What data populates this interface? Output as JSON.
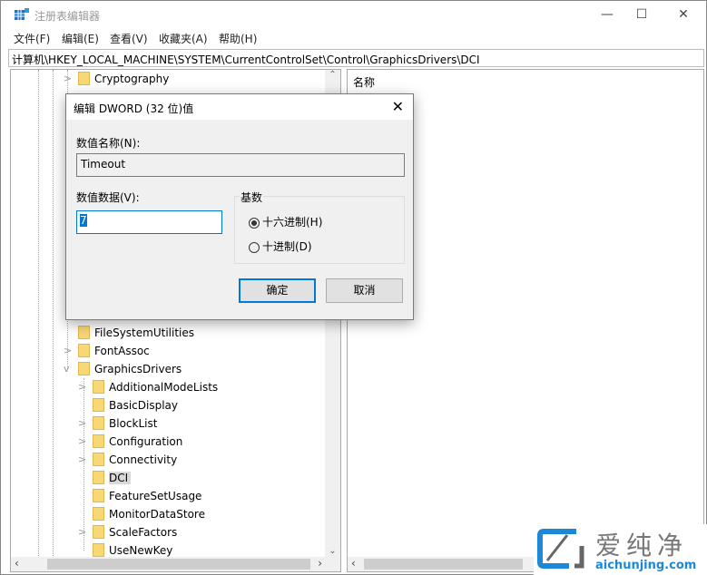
{
  "window": {
    "title": "注册表编辑器",
    "controls": [
      "—",
      "☐",
      "✕"
    ]
  },
  "menu": [
    "文件(F)",
    "编辑(E)",
    "查看(V)",
    "收藏夹(A)",
    "帮助(H)"
  ],
  "address": "计算机\\HKEY_LOCAL_MACHINE\\SYSTEM\\CurrentControlSet\\Control\\GraphicsDrivers\\DCI",
  "tree": {
    "level1": [
      {
        "label": "Cryptography",
        "expand": ">"
      },
      {
        "label": "FileSystemUtilities",
        "expand": ""
      },
      {
        "label": "FontAssoc",
        "expand": ">"
      },
      {
        "label": "GraphicsDrivers",
        "expand": "v"
      }
    ],
    "level2": [
      {
        "label": "AdditionalModeLists",
        "expand": ">"
      },
      {
        "label": "BasicDisplay",
        "expand": ""
      },
      {
        "label": "BlockList",
        "expand": ">"
      },
      {
        "label": "Configuration",
        "expand": ">"
      },
      {
        "label": "Connectivity",
        "expand": ">"
      },
      {
        "label": "DCI",
        "expand": "",
        "selected": true
      },
      {
        "label": "FeatureSetUsage",
        "expand": ""
      },
      {
        "label": "MonitorDataStore",
        "expand": ""
      },
      {
        "label": "ScaleFactors",
        "expand": ">"
      },
      {
        "label": "UseNewKey",
        "expand": ""
      }
    ]
  },
  "right": {
    "column_name": "名称"
  },
  "dialog": {
    "title": "编辑 DWORD (32 位)值",
    "name_label": "数值名称(N):",
    "name_value": "Timeout",
    "data_label": "数值数据(V):",
    "data_value": "7",
    "base_label": "基数",
    "hex_label": "十六进制(H)",
    "dec_label": "十进制(D)",
    "selected_base": "hex",
    "ok": "确定",
    "cancel": "取消"
  },
  "watermark": {
    "brand": "爱纯净",
    "url": "aichunjing.com"
  }
}
